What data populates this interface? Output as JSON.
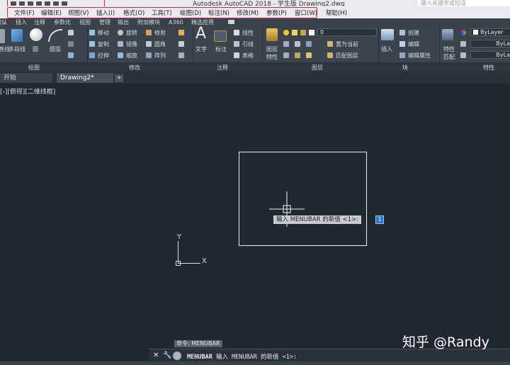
{
  "title": "Autodesk AutoCAD 2018 - 学生版    Drawing2.dwg",
  "search_placeholder": "键入关键字或短语",
  "menu": [
    "文件(F)",
    "编辑(E)",
    "视图(V)",
    "插入(I)",
    "格式(O)",
    "工具(T)",
    "绘图(D)",
    "标注(N)",
    "修改(M)",
    "参数(P)",
    "窗口(W)",
    "帮助(H)"
  ],
  "ribbon_tabs": [
    "默认",
    "插入",
    "注释",
    "参数化",
    "视图",
    "管理",
    "输出",
    "附加模块",
    "A360",
    "精选应用"
  ],
  "draw_panel": {
    "line": "直线",
    "polyline": "多段线",
    "circle": "圆",
    "arc": "圆弧",
    "title": "绘图"
  },
  "modify_panel": {
    "move": "移动",
    "rotate": "旋转",
    "trim": "修剪",
    "copy": "复制",
    "mirror": "镜像",
    "fillet": "圆角",
    "stretch": "拉伸",
    "scale": "缩放",
    "array": "阵列",
    "title": "修改"
  },
  "annotation_panel": {
    "text": "文字",
    "dimension": "标注",
    "linear": "线性",
    "leader": "引线",
    "table": "表格",
    "title": "注释"
  },
  "layers_panel": {
    "layer_props": "图层\n特性",
    "current_layer": "0",
    "make_current": "置为当前",
    "match_layer": "匹配图层",
    "title": "图层"
  },
  "block_panel": {
    "insert": "插入",
    "create": "创建",
    "edit": "编辑",
    "edit_attr": "编辑属性",
    "title": "块"
  },
  "properties_panel": {
    "match_props": "特性\n匹配",
    "bylayer": "ByLayer",
    "bylayer2": "ByLa",
    "bylayer3": "ByLa",
    "title": "特性"
  },
  "doc_tabs": [
    "开始",
    "Drawing2*"
  ],
  "viewport_label": "[-][俯视][二维线框]",
  "ucs": {
    "x": "X",
    "y": "Y"
  },
  "tooltip": "输入 MENUBAR 的新值 <1>:",
  "tooltip_value": "1",
  "cmd_history": "命令: MENUBAR",
  "cmd_name": "MENUBAR",
  "cmd_prompt": "输入 MENUBAR 的新值 <1>:",
  "watermark": "知乎 @Randy",
  "colors": {
    "canvas": "#212830",
    "menu_outline": "#e0263a",
    "ribbon": "#3b434c"
  }
}
